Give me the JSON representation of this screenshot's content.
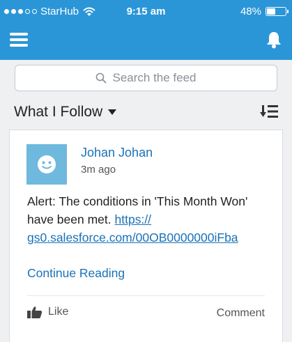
{
  "status_bar": {
    "carrier": "StarHub",
    "time": "9:15 am",
    "battery": "48%",
    "battery_level": 0.48
  },
  "nav": {
    "menu_icon": "hamburger-icon",
    "bell_icon": "bell-icon"
  },
  "search": {
    "placeholder": "Search the feed",
    "icon": "search-icon"
  },
  "feed": {
    "filter_label": "What I Follow",
    "sort_icon": "sort-icon"
  },
  "post": {
    "author": "Johan Johan",
    "timestamp": "3m ago",
    "text": "Alert: The conditions in 'This Month Won' have been met.",
    "link_line1": "https://",
    "link_line2": "gs0.salesforce.com/00OB0000000iFba",
    "continue_label": "Continue Reading",
    "like_label": "Like",
    "comment_label": "Comment"
  },
  "colors": {
    "header": "#2b96d7",
    "link": "#1a72b8",
    "avatar": "#6fb8de"
  }
}
